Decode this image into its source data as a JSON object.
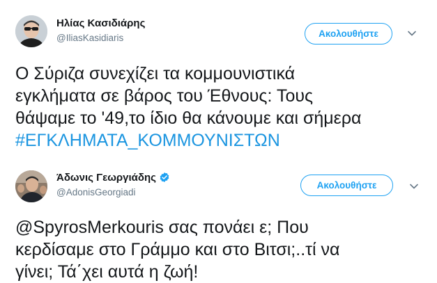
{
  "tweets": [
    {
      "name": "Ηλίας Κασιδιάρης",
      "handle": "@IliasKasidiaris",
      "verified": false,
      "follow_label": "Ακολουθήστε",
      "text_lines": [
        "Ο Σύριζα συνεχίζει τα κομμουνιστικά",
        "εγκλήματα σε βάρος του Έθνους: Τους",
        "θάψαμε το '49,το ίδιο θα κάνουμε και σήμερα"
      ],
      "hashtag": "#ΕΓΚΛΗΜΑΤΑ_ΚΟΜΜΟΥΝΙΣΤΩΝ"
    },
    {
      "name": "Άδωνις Γεωργιάδης",
      "handle": "@AdonisGeorgiadi",
      "verified": true,
      "follow_label": "Ακολουθήστε",
      "text_lines": [
        "@SpyrosMerkouris σας πονάει ε; Που",
        "κερδίσαμε στο Γράμμο και στο Βιτσι;..τί να",
        "γίνει; Τά΄χει αυτά η ζωή!"
      ]
    }
  ],
  "colors": {
    "accent": "#1da1f2",
    "hashtag": "#1b95e0",
    "text": "#14171a",
    "secondary": "#657786"
  },
  "icons": {
    "verified": "verified-badge-icon",
    "menu": "chevron-down-icon"
  }
}
